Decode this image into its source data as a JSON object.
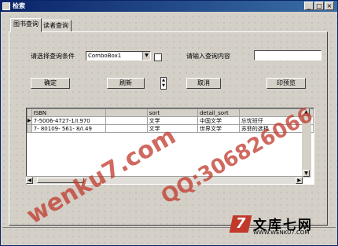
{
  "window": {
    "title": "检索",
    "min": "_",
    "max": "□",
    "close": "×"
  },
  "tabs": [
    {
      "label": "图书查询"
    },
    {
      "label": "读者查询"
    }
  ],
  "form": {
    "condition_label": "请选择查询条件",
    "combo_value": "ComboBox1",
    "input_label": "请输入查询内容",
    "input_value": ""
  },
  "buttons": {
    "ok": "确定",
    "refresh": "刷新",
    "cancel": "取消",
    "preview": "印预览"
  },
  "grid": {
    "columns": [
      "ISBN",
      "",
      "sort",
      "detail_sort",
      ""
    ],
    "rows": [
      {
        "indicator": "▶",
        "cells": [
          "7-5006-4727-1/I.970",
          "",
          "文学",
          "中国文学",
          "忘忧班仔"
        ]
      },
      {
        "indicator": "",
        "cells": [
          "7- 80109- 561- 8/I.49",
          "",
          "文学",
          "世界文学",
          "苏菲的选择"
        ]
      }
    ]
  },
  "watermark": {
    "site": "wenku7.com",
    "qq": "QQ:306826066"
  },
  "logo": {
    "mark": "7",
    "name": "文库七网",
    "url": "WWW.WENKU7.COM"
  }
}
